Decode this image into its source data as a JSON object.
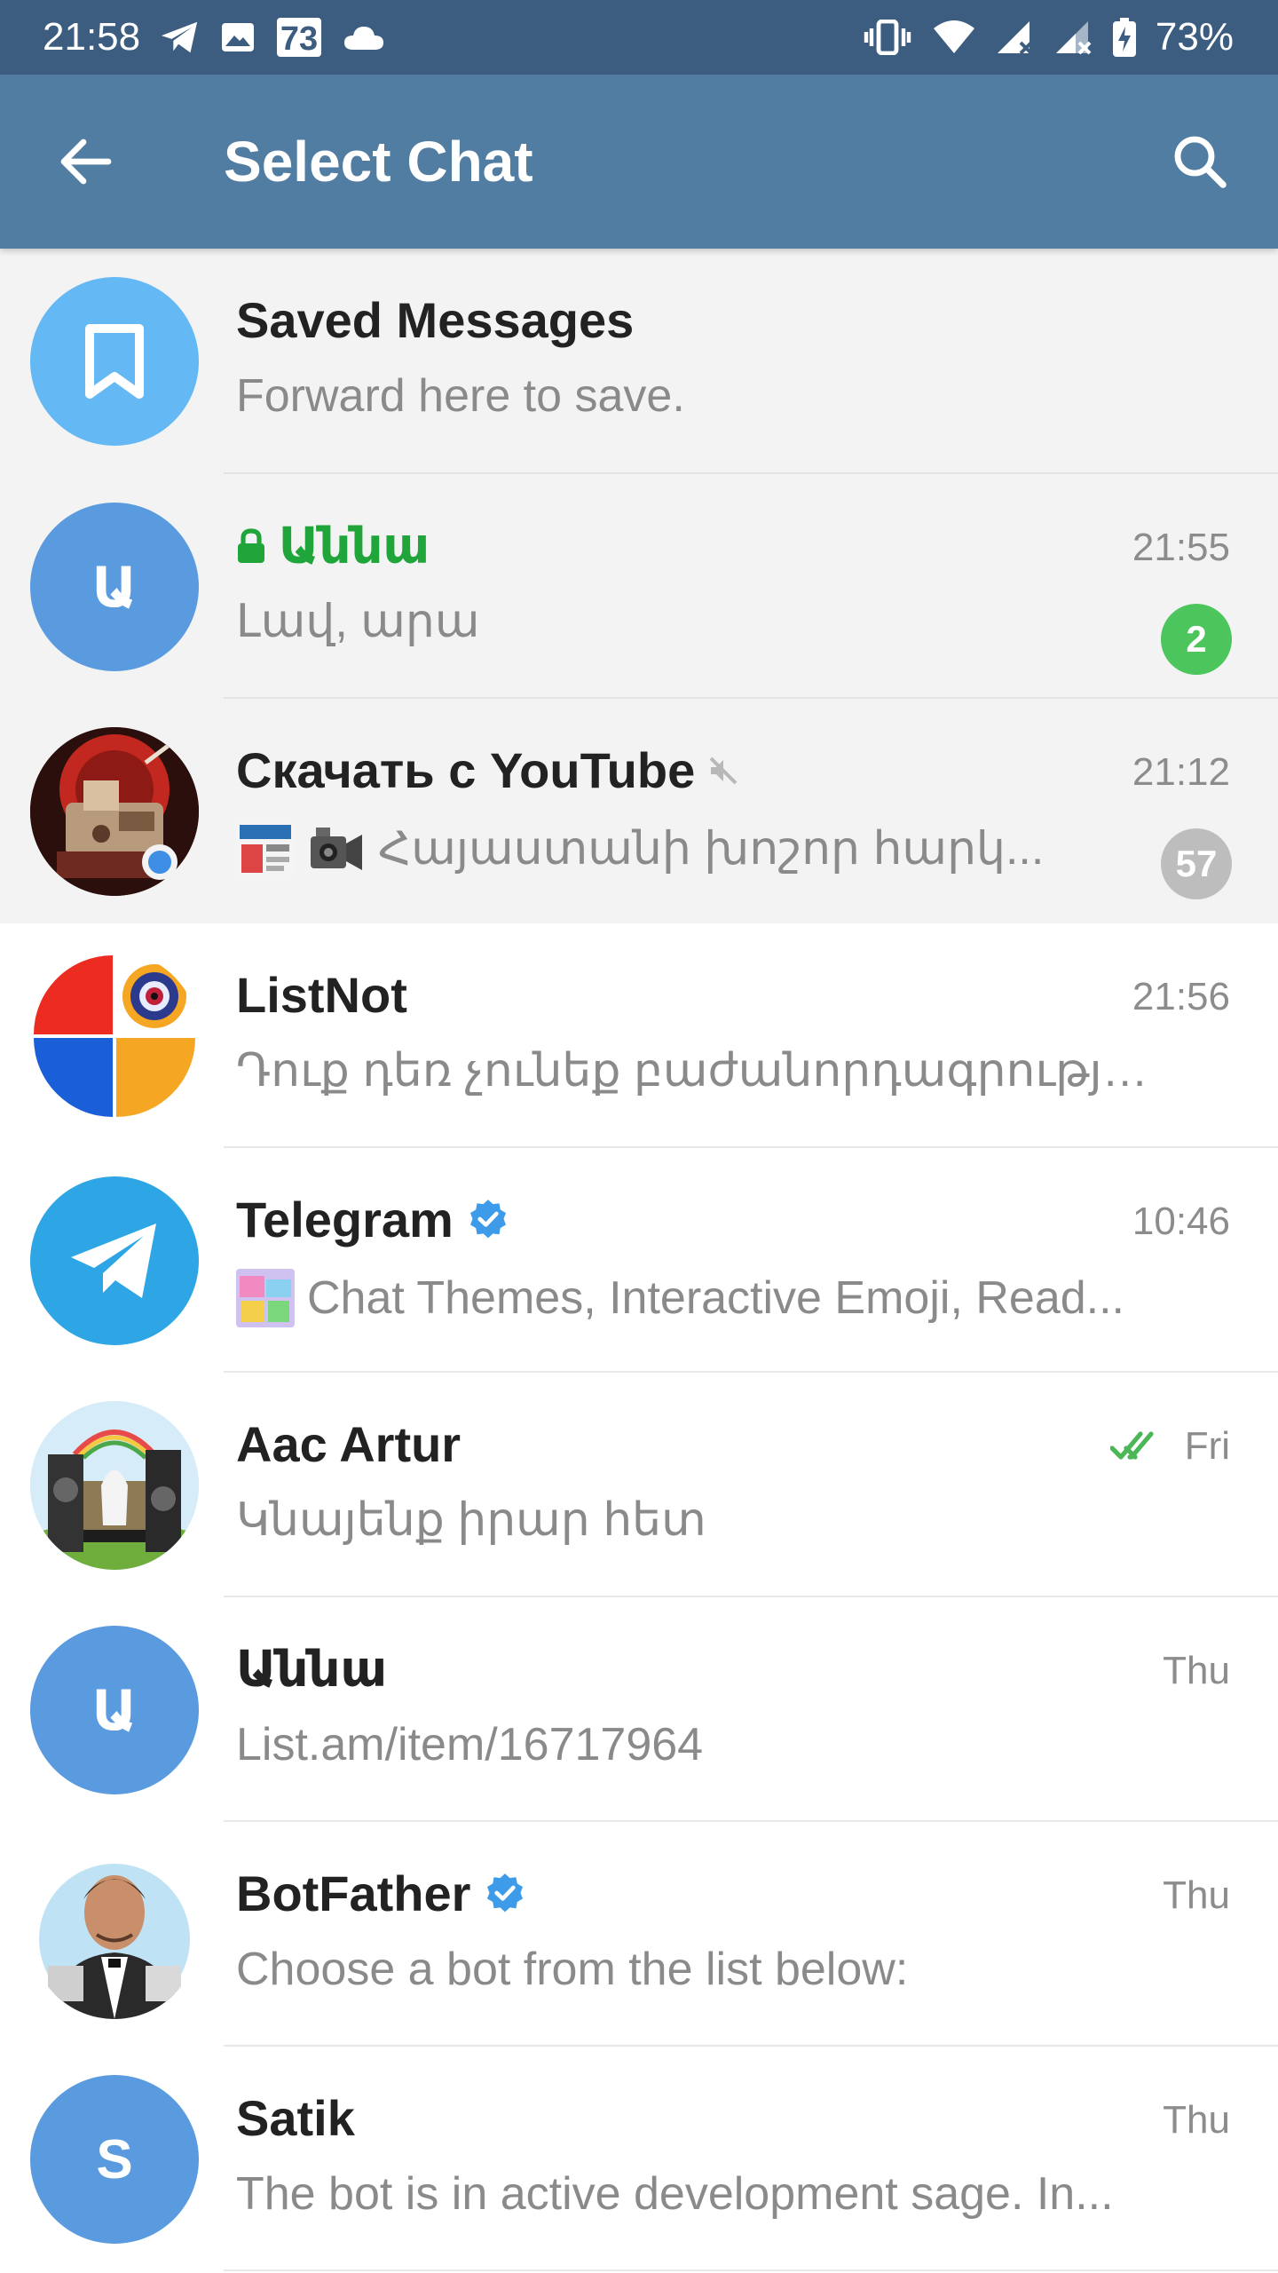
{
  "status_bar": {
    "time": "21:58",
    "notif_73": "73",
    "battery": "73%"
  },
  "app_bar": {
    "title": "Select Chat"
  },
  "colors": {
    "status_bar": "#3d5d80",
    "app_bar": "#517da2",
    "badge_unread": "#4cc55d",
    "badge_muted": "#bdbdbd",
    "verified": "#3d9be9",
    "secret_green": "#1fa53a"
  },
  "chats": [
    {
      "name": "Saved Messages",
      "message": "Forward here to save.",
      "time": "",
      "badge": "",
      "avatar_icon": "bookmark-icon"
    },
    {
      "name": "Աննա",
      "message": "Լավ, արա",
      "time": "21:55",
      "badge": "2",
      "avatar_letter": "Ա"
    },
    {
      "name": "Скачать с YouTube",
      "message": "Հայաստանի խոշոր հարկ...",
      "time": "21:12",
      "badge": "57"
    },
    {
      "name": "ListNot",
      "message": "Դուք դեռ չունեք բաժանորդագրությու...",
      "time": "21:56",
      "badge": ""
    },
    {
      "name": "Telegram",
      "message": "Chat Themes, Interactive Emoji, Read...",
      "time": "10:46",
      "badge": ""
    },
    {
      "name": "Aac Artur",
      "message": "Կնայենք իրար հետ",
      "time": "Fri",
      "badge": ""
    },
    {
      "name": "Աննա",
      "message": "List.am/item/16717964",
      "time": "Thu",
      "badge": "",
      "avatar_letter": "Ա"
    },
    {
      "name": "BotFather",
      "message": "Choose a bot from the list below:",
      "time": "Thu",
      "badge": ""
    },
    {
      "name": "Satik",
      "message": "The bot is in active development sage. In...",
      "time": "Thu",
      "badge": "",
      "avatar_letter": "S"
    }
  ]
}
